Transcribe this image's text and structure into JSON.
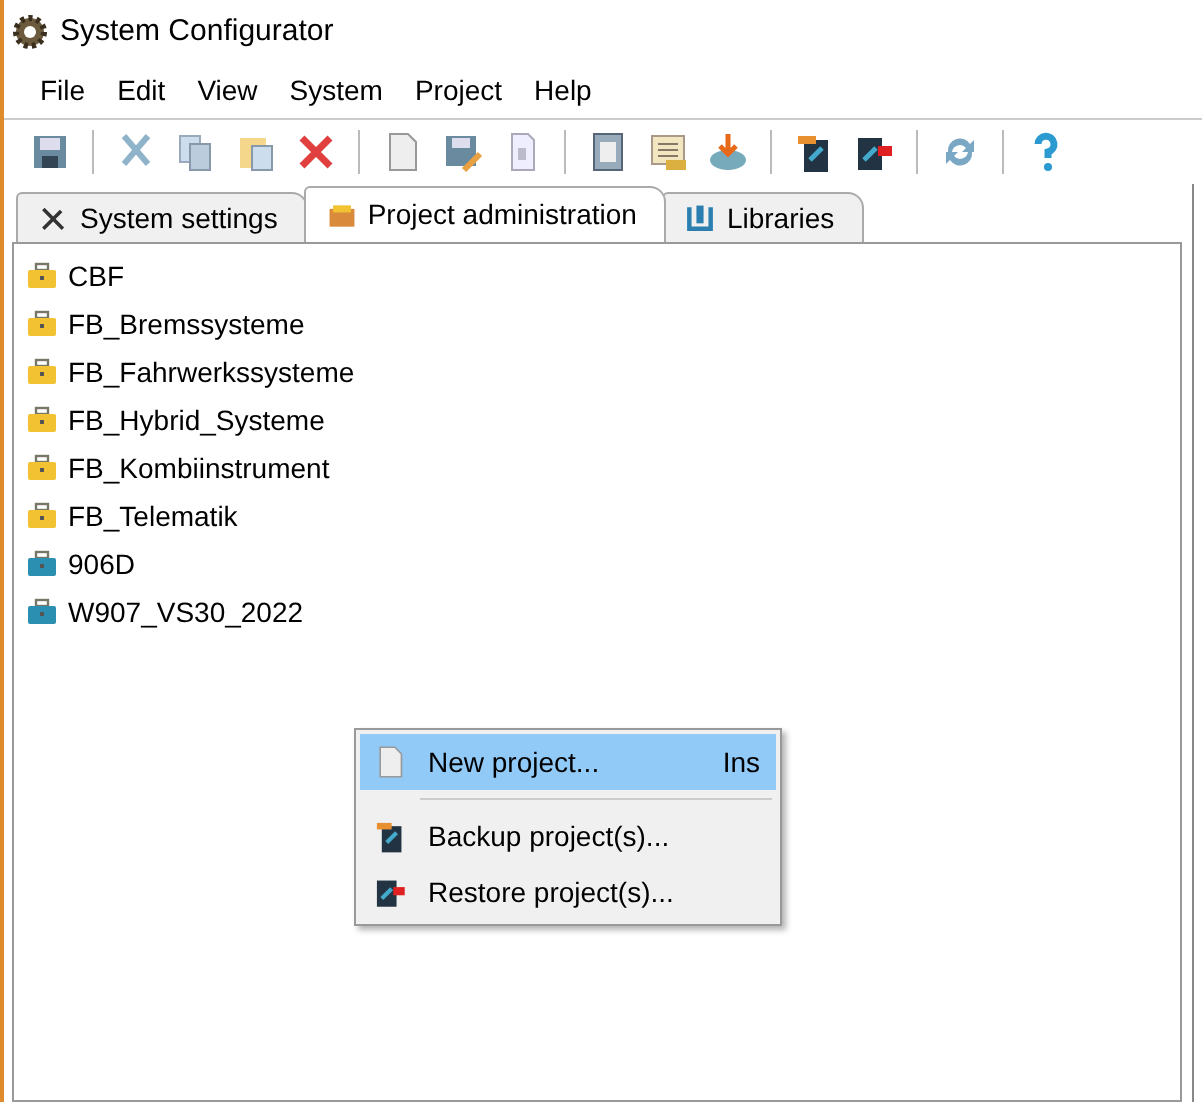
{
  "window": {
    "title": "System Configurator"
  },
  "menu": [
    "File",
    "Edit",
    "View",
    "System",
    "Project",
    "Help"
  ],
  "tabs": [
    {
      "label": "System settings",
      "selected": false
    },
    {
      "label": "Project administration",
      "selected": true
    },
    {
      "label": "Libraries",
      "selected": false
    }
  ],
  "tree": [
    {
      "label": "CBF",
      "color": "#f2c232"
    },
    {
      "label": "FB_Bremssysteme",
      "color": "#f2c232"
    },
    {
      "label": "FB_Fahrwerkssysteme",
      "color": "#f2c232"
    },
    {
      "label": "FB_Hybrid_Systeme",
      "color": "#f2c232"
    },
    {
      "label": "FB_Kombiinstrument",
      "color": "#f2c232"
    },
    {
      "label": "FB_Telematik",
      "color": "#f2c232"
    },
    {
      "label": "906D",
      "color": "#2a8fb0"
    },
    {
      "label": "W907_VS30_2022",
      "color": "#2a8fb0"
    }
  ],
  "context_menu": [
    {
      "kind": "item",
      "label": "New project...",
      "shortcut": "Ins",
      "selected": true
    },
    {
      "kind": "separator"
    },
    {
      "kind": "item",
      "label": "Backup project(s)...",
      "selected": false
    },
    {
      "kind": "item",
      "label": "Restore project(s)...",
      "selected": false
    }
  ]
}
